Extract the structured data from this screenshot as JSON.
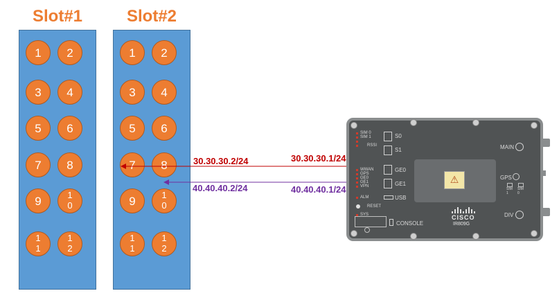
{
  "slots": [
    {
      "title": "Slot#1",
      "ports": [
        "1",
        "2",
        "3",
        "4",
        "5",
        "6",
        "7",
        "8",
        "9",
        "1\n0",
        "1\n1",
        "1\n2"
      ]
    },
    {
      "title": "Slot#2",
      "ports": [
        "1",
        "2",
        "3",
        "4",
        "5",
        "6",
        "7",
        "8",
        "9",
        "1\n0",
        "1\n1",
        "1\n2"
      ]
    }
  ],
  "links": [
    {
      "left_ip": "30.30.30.2/24",
      "right_ip": "30.30.30.1/24",
      "color": "#C00000"
    },
    {
      "left_ip": "40.40.40.2/24",
      "right_ip": "40.40.40.1/24",
      "color": "#7030A0"
    }
  ],
  "device": {
    "model": "IR809G",
    "brand": "CISCO",
    "leds_top": [
      "SIM 0",
      "SIM 1",
      "",
      ""
    ],
    "rssi": "RSSI",
    "s0": "S0",
    "s1": "S1",
    "leds_mid": [
      "WWAN",
      "GPS",
      "GE0",
      "GE1",
      "VPN"
    ],
    "ge0": "GE0",
    "ge1": "GE1",
    "alm": "ALM",
    "usb": "USB",
    "reset": "RESET",
    "sys": "SYS",
    "console": "CONSOLE",
    "main": "MAIN",
    "gps": "GPS",
    "div": "DIV",
    "sim_leds": [
      "SIM\n1",
      "SIM\n0"
    ]
  },
  "colors": {
    "slot_title": "#ED7D31",
    "panel": "#5B9BD5",
    "port": "#ED7D31"
  }
}
